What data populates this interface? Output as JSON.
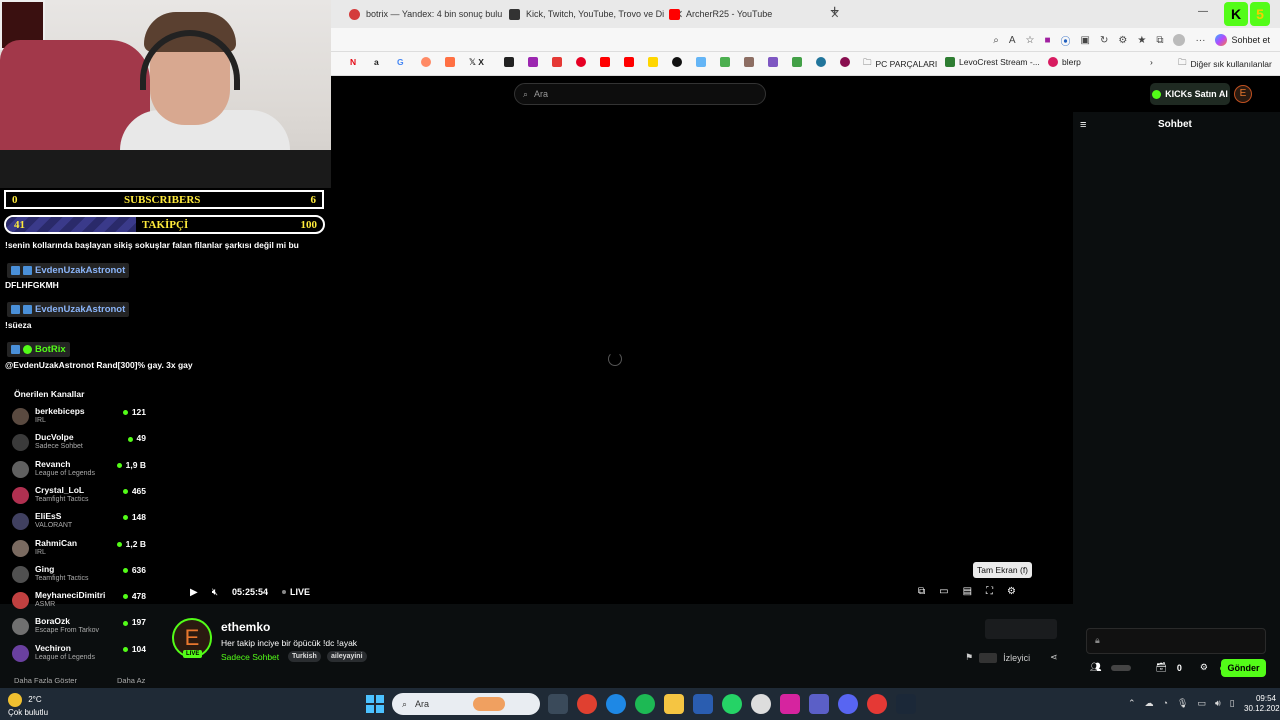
{
  "browser": {
    "tabs": [
      {
        "label": "botrix — Yandex: 4 bin sonuç bulu",
        "color": "#d43c3c"
      },
      {
        "label": "Kick, Twitch, YouTube, Trovo ve Di",
        "color": "#333333"
      },
      {
        "label": "ArcherR25 - YouTube",
        "color": "#ff0000"
      }
    ],
    "copilot_label": "Sohbet et",
    "bookmarks": [
      "PC PARÇALARI",
      "LevoCrest Stream -...",
      "blerp",
      "Diğer sık kullanılanlar"
    ]
  },
  "kick": {
    "search_placeholder": "Ara",
    "buy_button": "KICKs Satın Al",
    "chat_title": "Sohbet",
    "send_button": "Gönder",
    "chat_count": "0",
    "tooltip": "Tam Ekran (f)",
    "player": {
      "time": "05:25:54",
      "live": "LIVE"
    },
    "stream": {
      "streamer": "ethemko",
      "title": "Her takip inciye bir öpücük !dc !ayak",
      "category": "Sadece Sohbet",
      "tags": [
        "Turkish",
        "aileyayini"
      ],
      "live_badge": "LIVE",
      "viewers_label": "İzleyici"
    },
    "suggested_title": "Önerilen Kanallar",
    "suggested": [
      {
        "name": "berkebiceps",
        "category": "IRL",
        "viewers": "121"
      },
      {
        "name": "DucVolpe",
        "category": "Sadece Sohbet",
        "viewers": "49"
      },
      {
        "name": "Revanch",
        "category": "League of Legends",
        "viewers": "1,9 B"
      },
      {
        "name": "Crystal_LoL",
        "category": "Teamfight Tactics",
        "viewers": "465"
      },
      {
        "name": "EliEsS",
        "category": "VALORANT",
        "viewers": "148"
      },
      {
        "name": "RahmiCan",
        "category": "IRL",
        "viewers": "1,2 B"
      },
      {
        "name": "Ging",
        "category": "Teamfight Tactics",
        "viewers": "636"
      },
      {
        "name": "MeyhaneciDimitri",
        "category": "ASMR",
        "viewers": "478"
      },
      {
        "name": "BoraOzk",
        "category": "Escape From Tarkov",
        "viewers": "197"
      },
      {
        "name": "Vechiron",
        "category": "League of Legends",
        "viewers": "104"
      }
    ],
    "show_more": "Daha Fazla Göster",
    "show_less": "Daha Az"
  },
  "overlay": {
    "subscribers": {
      "left": "0",
      "label": "SUBSCRIBERS",
      "right": "6"
    },
    "followers": {
      "left": "41",
      "label": "TAKİPÇİ",
      "right": "100",
      "progress": 0.41
    },
    "messages": [
      {
        "type": "text",
        "text": "!senin kollarında başlayan sikiş sokuşlar falan filanlar şarkısı değil mi bu"
      },
      {
        "type": "user",
        "text": "EvdenUzakAstronot"
      },
      {
        "type": "text",
        "text": "DFLHFGKMH"
      },
      {
        "type": "user",
        "text": "EvdenUzakAstronot"
      },
      {
        "type": "text",
        "text": "!süeza"
      },
      {
        "type": "bot",
        "text": "BotRix"
      },
      {
        "type": "text",
        "text": "@EvdenUzakAstronot Rand[300]% gay. 3x gay"
      }
    ]
  },
  "taskbar": {
    "temp": "2°C",
    "weather": "Çok bulutlu",
    "search": "Ara",
    "time": "09:54",
    "date": "30.12.2025"
  }
}
